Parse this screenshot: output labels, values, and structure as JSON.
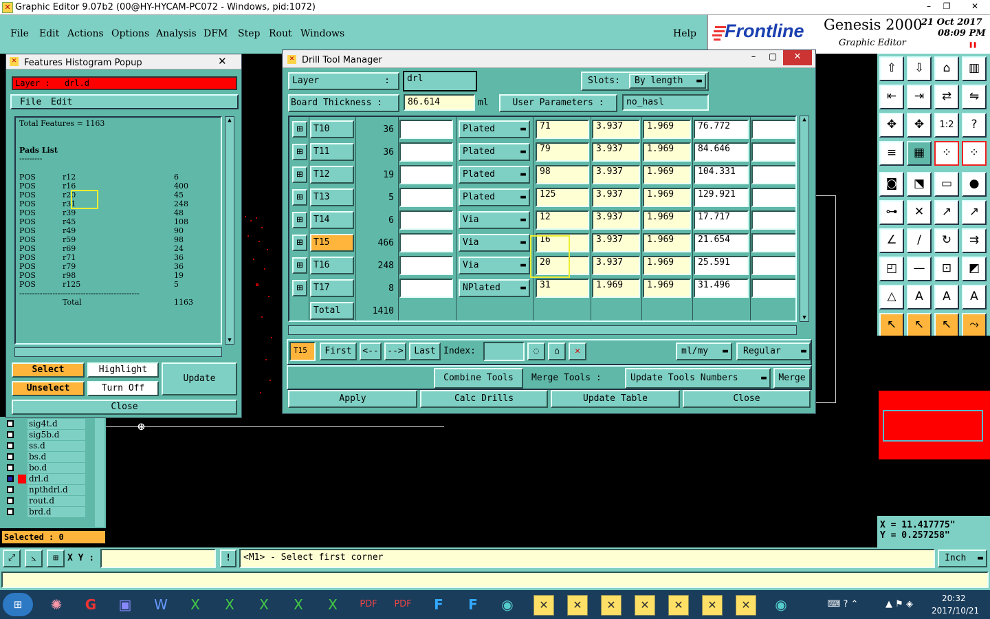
{
  "window": {
    "title": "Graphic Editor 9.07b2 (00@HY-HYCAM-PC072 - Windows, pid:1072)"
  },
  "menu": [
    "File",
    "Edit",
    "Actions",
    "Options",
    "Analysis",
    "DFM",
    "Step",
    "Rout",
    "Windows"
  ],
  "help": "Help",
  "brand": {
    "logo": "Frontline",
    "product": "Genesis 2000",
    "subtitle": "Graphic Editor",
    "date": "21 Oct 2017",
    "time": "08:09 PM"
  },
  "histogram": {
    "title": "Features Histogram Popup",
    "layer_label": "Layer :",
    "layer_value": "drl.d",
    "menu": [
      "File",
      "Edit"
    ],
    "total_features": "Total Features = 1163",
    "pads_heading": "Pads List",
    "pads_rule": "---------",
    "rows": [
      {
        "pol": "POS",
        "sym": "r12",
        "count": "6"
      },
      {
        "pol": "POS",
        "sym": "r16",
        "count": "400"
      },
      {
        "pol": "POS",
        "sym": "r20",
        "count": "45"
      },
      {
        "pol": "POS",
        "sym": "r31",
        "count": "248"
      },
      {
        "pol": "POS",
        "sym": "r39",
        "count": "48"
      },
      {
        "pol": "POS",
        "sym": "r45",
        "count": "108"
      },
      {
        "pol": "POS",
        "sym": "r49",
        "count": "90"
      },
      {
        "pol": "POS",
        "sym": "r59",
        "count": "98"
      },
      {
        "pol": "POS",
        "sym": "r69",
        "count": "24"
      },
      {
        "pol": "POS",
        "sym": "r71",
        "count": "36"
      },
      {
        "pol": "POS",
        "sym": "r79",
        "count": "36"
      },
      {
        "pol": "POS",
        "sym": "r98",
        "count": "19"
      },
      {
        "pol": "POS",
        "sym": "r125",
        "count": "5"
      }
    ],
    "total_label": "Total",
    "total_value": "1163",
    "buttons": {
      "select": "Select",
      "highlight": "Highlight",
      "update": "Update",
      "unselect": "Unselect",
      "turn_off": "Turn Off",
      "close": "Close"
    }
  },
  "layers": [
    "sig4t.d",
    "sig5b.d",
    "ss.d",
    "bs.d",
    "bo.d",
    "drl.d",
    "npthdrl.d",
    "rout.d",
    "brd.d"
  ],
  "selected": "Selected : 0",
  "drill": {
    "title": "Drill Tool Manager",
    "layer_label": "Layer",
    "layer_colon": ":",
    "layer_value": "drl",
    "slots_label": "Slots:",
    "slots_value": "By length",
    "thickness_label": "Board Thickness :",
    "thickness_value": "86.614",
    "thickness_unit": "ml",
    "user_params_label": "User Parameters :",
    "user_params_value": "no_hasl",
    "tools": [
      {
        "name": "T10",
        "count": "36",
        "type": "Plated",
        "size": "71",
        "tol1": "3.937",
        "tol2": "1.969",
        "finish": "76.772"
      },
      {
        "name": "T11",
        "count": "36",
        "type": "Plated",
        "size": "79",
        "tol1": "3.937",
        "tol2": "1.969",
        "finish": "84.646"
      },
      {
        "name": "T12",
        "count": "19",
        "type": "Plated",
        "size": "98",
        "tol1": "3.937",
        "tol2": "1.969",
        "finish": "104.331"
      },
      {
        "name": "T13",
        "count": "5",
        "type": "Plated",
        "size": "125",
        "tol1": "3.937",
        "tol2": "1.969",
        "finish": "129.921"
      },
      {
        "name": "T14",
        "count": "6",
        "type": "Via",
        "size": "12",
        "tol1": "3.937",
        "tol2": "1.969",
        "finish": "17.717"
      },
      {
        "name": "T15",
        "count": "466",
        "type": "Via",
        "size": "16",
        "tol1": "3.937",
        "tol2": "1.969",
        "finish": "21.654"
      },
      {
        "name": "T16",
        "count": "248",
        "type": "Via",
        "size": "20",
        "tol1": "3.937",
        "tol2": "1.969",
        "finish": "25.591"
      },
      {
        "name": "T17",
        "count": "8",
        "type": "NPlated",
        "size": "31",
        "tol1": "1.969",
        "tol2": "1.969",
        "finish": "31.496"
      }
    ],
    "total_label": "Total",
    "total_value": "1410",
    "current_tool": "T15",
    "nav": {
      "first": "First",
      "prev": "<--",
      "next": "-->",
      "last": "Last",
      "index_label": "Index:"
    },
    "units_value": "ml/my",
    "mode_value": "Regular",
    "combine": "Combine Tools",
    "merge_tools_label": "Merge Tools :",
    "update_numbers": "Update Tools Numbers",
    "merge": "Merge",
    "apply": "Apply",
    "calc": "Calc Drills",
    "update_table": "Update Table",
    "close": "Close"
  },
  "coords": {
    "x": "X = 11.417775\"",
    "y": "Y = 0.257258\""
  },
  "bottom": {
    "xy_label": "X Y :",
    "message": "<M1> - Select first corner",
    "units": "Inch"
  },
  "clock": {
    "time": "20:32",
    "date": "2017/10/21"
  },
  "colors": {
    "panel": "#5fb8a8",
    "button": "#7fd0c4",
    "highlight": "#ffb43c",
    "alert": "#ff0000",
    "field_yellow": "#ffffd4"
  }
}
